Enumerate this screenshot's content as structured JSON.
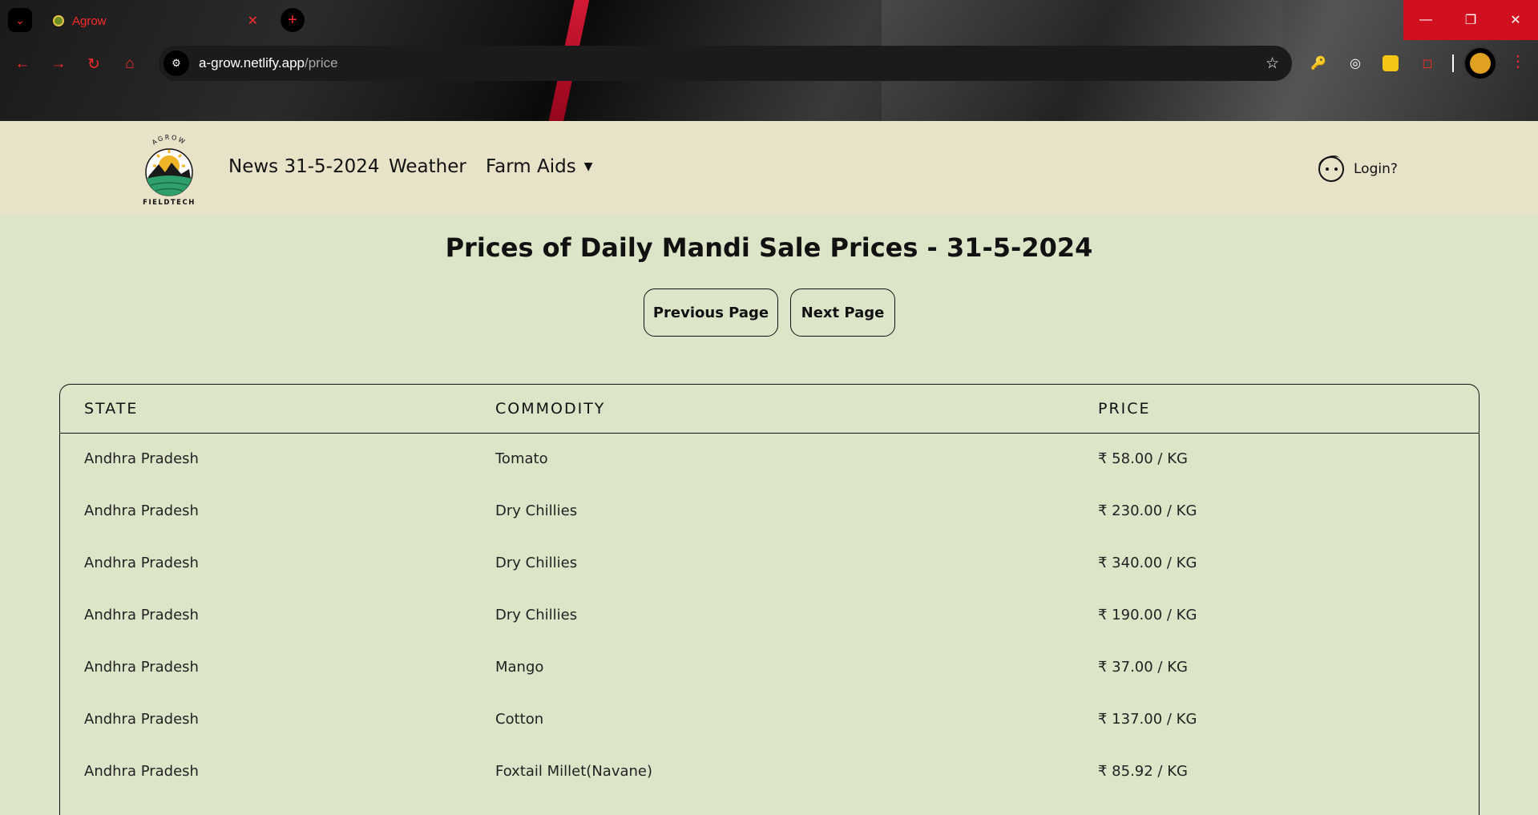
{
  "browser": {
    "tab_title": "Agrow",
    "url_domain": "a-grow.netlify.app",
    "url_path": "/price"
  },
  "header": {
    "logo_top_text": "AGROW",
    "logo_bottom_text": "FIELDTECH",
    "nav": {
      "news": "News 31-5-2024",
      "weather": "Weather",
      "farm_aids": "Farm Aids"
    },
    "login": "Login?"
  },
  "main": {
    "title": "Prices of Daily Mandi Sale Prices - 31-5-2024",
    "prev_label": "Previous Page",
    "next_label": "Next Page",
    "table": {
      "headers": [
        "STATE",
        "COMMODITY",
        "PRICE"
      ],
      "rows": [
        [
          "Andhra Pradesh",
          "Tomato",
          "₹ 58.00 / KG"
        ],
        [
          "Andhra Pradesh",
          "Dry Chillies",
          "₹ 230.00 / KG"
        ],
        [
          "Andhra Pradesh",
          "Dry Chillies",
          "₹ 340.00 / KG"
        ],
        [
          "Andhra Pradesh",
          "Dry Chillies",
          "₹ 190.00 / KG"
        ],
        [
          "Andhra Pradesh",
          "Mango",
          "₹ 37.00 / KG"
        ],
        [
          "Andhra Pradesh",
          "Cotton",
          "₹ 137.00 / KG"
        ],
        [
          "Andhra Pradesh",
          "Foxtail Millet(Navane)",
          "₹ 85.92 / KG"
        ]
      ]
    }
  },
  "colors": {
    "page_bg": "#dde5c8",
    "header_bg": "#e8e2c9",
    "browser_accent": "#ff2a2a"
  },
  "icons": {
    "tab_menu": "chevron-down-icon",
    "reload": "reload-icon",
    "home": "home-icon",
    "star": "star-icon",
    "login": "face-icon"
  }
}
